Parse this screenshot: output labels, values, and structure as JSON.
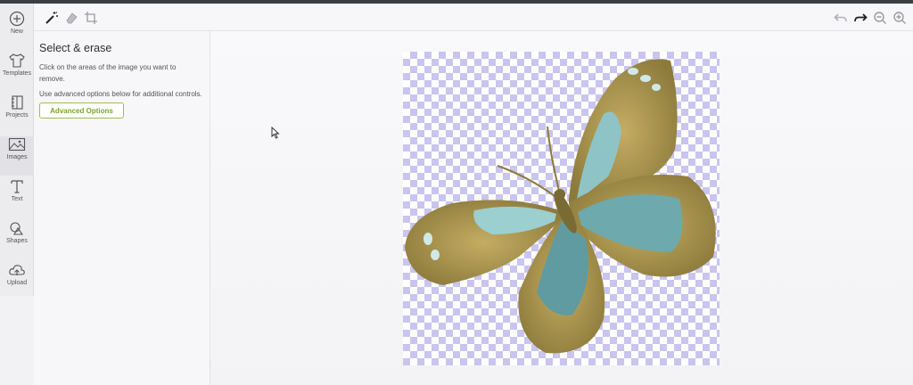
{
  "rail": {
    "items": [
      {
        "label": "New",
        "icon": "plus-circle-icon"
      },
      {
        "label": "Templates",
        "icon": "tshirt-icon"
      },
      {
        "label": "Projects",
        "icon": "notebook-icon"
      },
      {
        "label": "Images",
        "icon": "image-icon"
      },
      {
        "label": "Text",
        "icon": "text-t-icon"
      },
      {
        "label": "Shapes",
        "icon": "shapes-icon"
      },
      {
        "label": "Upload",
        "icon": "cloud-upload-icon"
      }
    ]
  },
  "toolbar": {
    "left_tools": [
      "magic-wand-icon",
      "eraser-icon",
      "crop-icon"
    ],
    "right_tools": [
      "undo-icon",
      "redo-icon",
      "zoom-out-icon",
      "zoom-in-icon"
    ]
  },
  "panel": {
    "title": "Select & erase",
    "instruction": "Click on the areas of the image you want to remove.",
    "advanced_hint": "Use advanced options below for additional controls.",
    "advanced_button": "Advanced Options"
  },
  "colors": {
    "accent_green": "#9dbd4a",
    "checker": "#c9c5ef",
    "butterfly_gold": "#a8924a",
    "butterfly_teal": "#7fb8bd"
  }
}
